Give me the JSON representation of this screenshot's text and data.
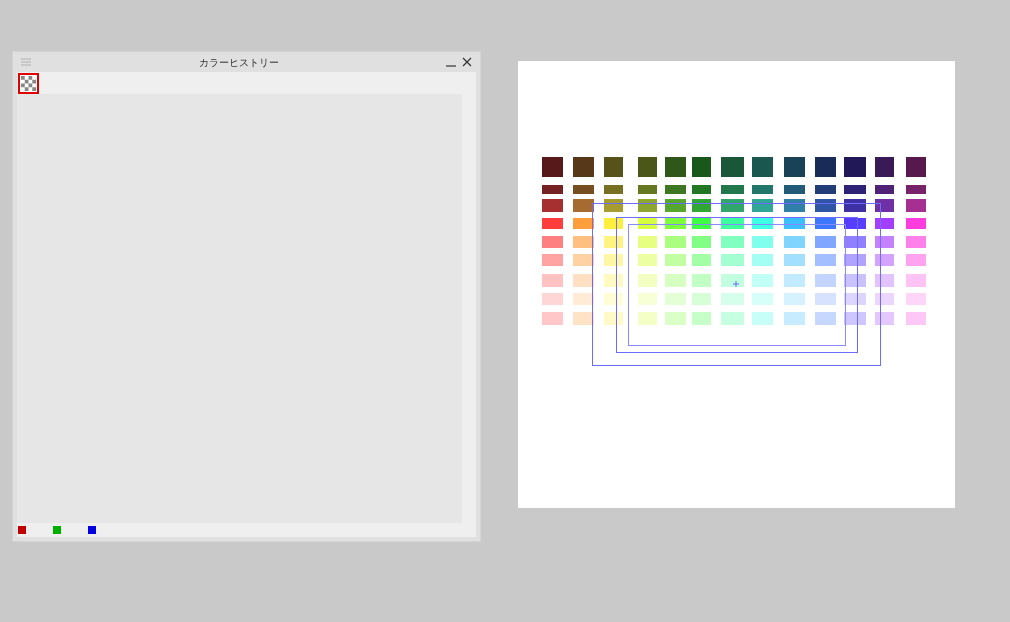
{
  "window": {
    "title": "カラーヒストリー"
  },
  "history": [
    {
      "color": "#c00000"
    },
    {
      "color": "#00b000"
    },
    {
      "color": "#0000e0"
    }
  ]
}
